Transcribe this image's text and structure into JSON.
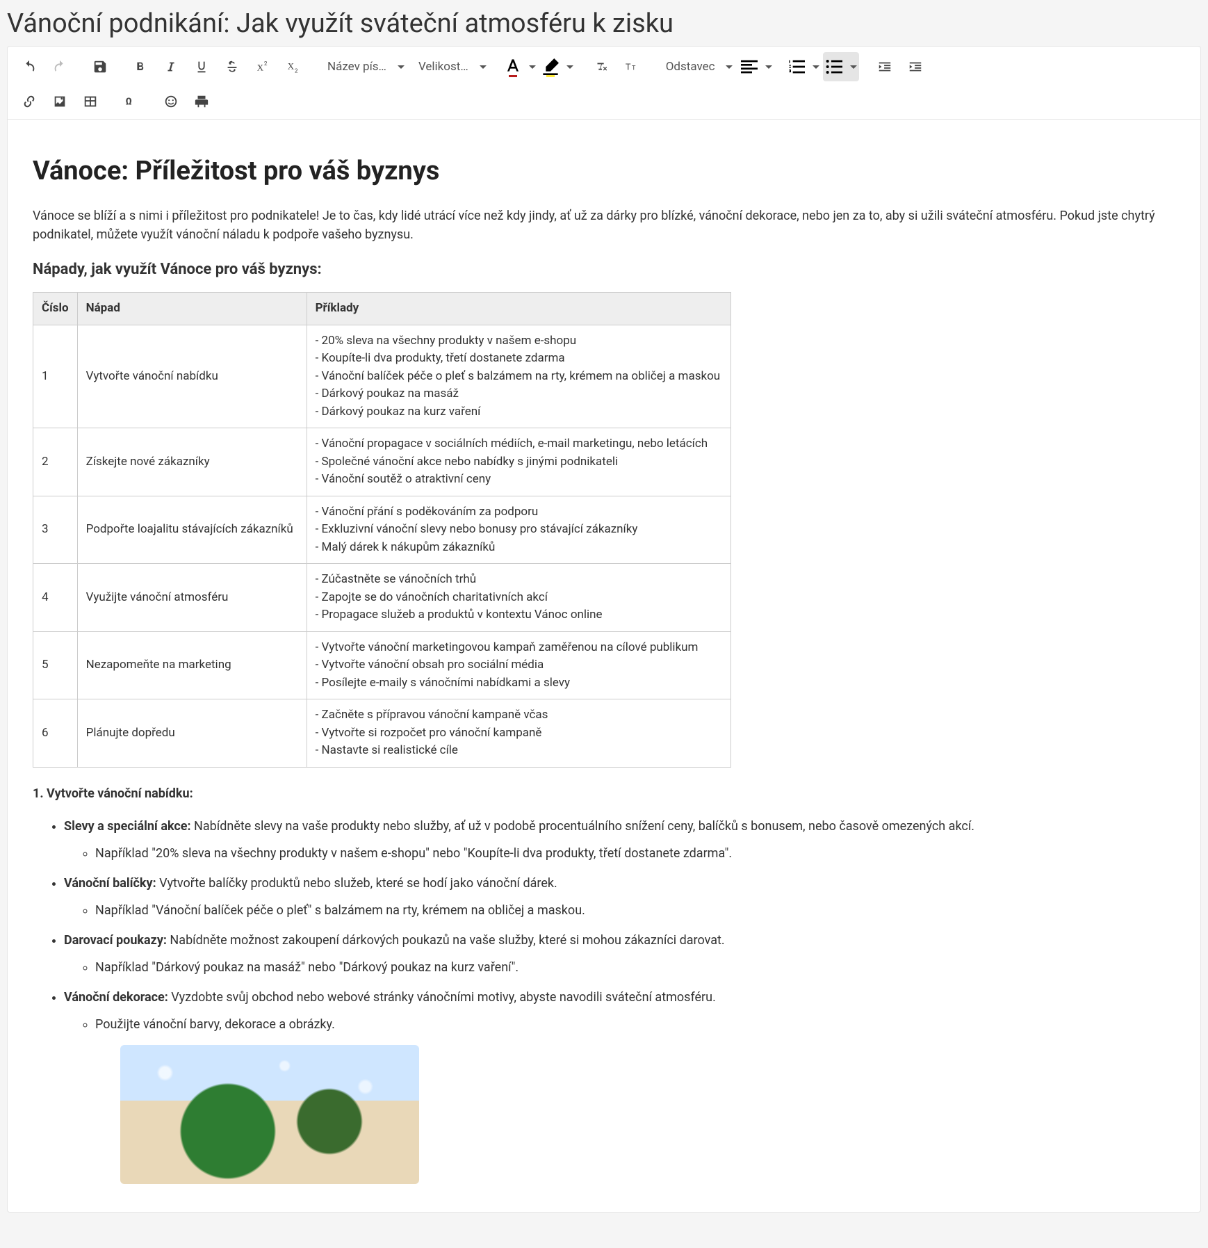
{
  "page_title": "Vánoční podnikání: Jak využít sváteční atmosféru k zisku",
  "toolbar": {
    "font_family": "Název pís…",
    "font_size": "Velikost…",
    "block_format": "Odstavec"
  },
  "doc": {
    "h2": "Vánoce: Příležitost pro váš byznys",
    "intro": "Vánoce se blíží a s nimi i příležitost pro podnikatele! Je to čas, kdy lidé utrácí více než kdy jindy, ať už za dárky pro blízké, vánoční dekorace, nebo jen za to, aby si užili sváteční atmosféru. Pokud jste chytrý podnikatel, můžete využít vánoční náladu k podpoře vašeho byznysu.",
    "h3": "Nápady, jak využít Vánoce pro váš byznys:",
    "table": {
      "headers": [
        "Číslo",
        "Nápad",
        "Příklady"
      ],
      "rows": [
        {
          "n": "1",
          "idea": "Vytvořte vánoční nabídku",
          "examples": "- 20% sleva na všechny produkty v našem e-shopu\n- Koupíte-li dva produkty, třetí dostanete zdarma\n- Vánoční balíček péče o pleť s balzámem na rty, krémem na obličej a maskou\n- Dárkový poukaz na masáž\n- Dárkový poukaz na kurz vaření"
        },
        {
          "n": "2",
          "idea": "Získejte nové zákazníky",
          "examples": "- Vánoční propagace v sociálních médiích, e-mail marketingu, nebo letácích\n- Společné vánoční akce nebo nabídky s jinými podnikateli\n- Vánoční soutěž o atraktivní ceny"
        },
        {
          "n": "3",
          "idea": "Podpořte loajalitu stávajících zákazníků",
          "examples": "- Vánoční přání s poděkováním za podporu\n- Exkluzivní vánoční slevy nebo bonusy pro stávající zákazníky\n- Malý dárek k nákupům zákazníků"
        },
        {
          "n": "4",
          "idea": "Využijte vánoční atmosféru",
          "examples": "- Zúčastněte se vánočních trhů\n- Zapojte se do vánočních charitativních akcí\n- Propagace služeb a produktů v kontextu Vánoc online"
        },
        {
          "n": "5",
          "idea": "Nezapomeňte na marketing",
          "examples": "- Vytvořte vánoční marketingovou kampaň zaměřenou na cílové publikum\n- Vytvořte vánoční obsah pro sociální média\n- Posílejte e-maily s vánočními nabídkami a slevy"
        },
        {
          "n": "6",
          "idea": "Plánujte dopředu",
          "examples": "- Začněte s přípravou vánoční kampaně včas\n- Vytvořte si rozpočet pro vánoční kampaně\n- Nastavte si realistické cíle"
        }
      ]
    },
    "section_lead": "1. Vytvořte vánoční nabídku:",
    "bullets": [
      {
        "lead": "Slevy a speciální akce:",
        "rest": " Nabídněte slevy na vaše produkty nebo služby, ať už v podobě procentuálního snížení ceny, balíčků s bonusem, nebo časově omezených akcí.",
        "sub": "Například \"20% sleva na všechny produkty v našem e-shopu\" nebo \"Koupíte-li dva produkty, třetí dostanete zdarma\"."
      },
      {
        "lead": "Vánoční balíčky:",
        "rest": " Vytvořte balíčky produktů nebo služeb, které se hodí jako vánoční dárek.",
        "sub": "Například \"Vánoční balíček péče o pleť\" s balzámem na rty, krémem na obličej a maskou."
      },
      {
        "lead": "Darovací poukazy:",
        "rest": " Nabídněte možnost zakoupení dárkových poukazů na vaše služby, které si mohou zákazníci darovat.",
        "sub": "Například \"Dárkový poukaz na masáž\" nebo \"Dárkový poukaz na kurz vaření\"."
      },
      {
        "lead": "Vánoční dekorace:",
        "rest": " Vyzdobte svůj obchod nebo webové stránky vánočními motivy, abyste navodili sváteční atmosféru.",
        "sub": "Použijte vánoční barvy, dekorace a obrázky."
      }
    ]
  }
}
